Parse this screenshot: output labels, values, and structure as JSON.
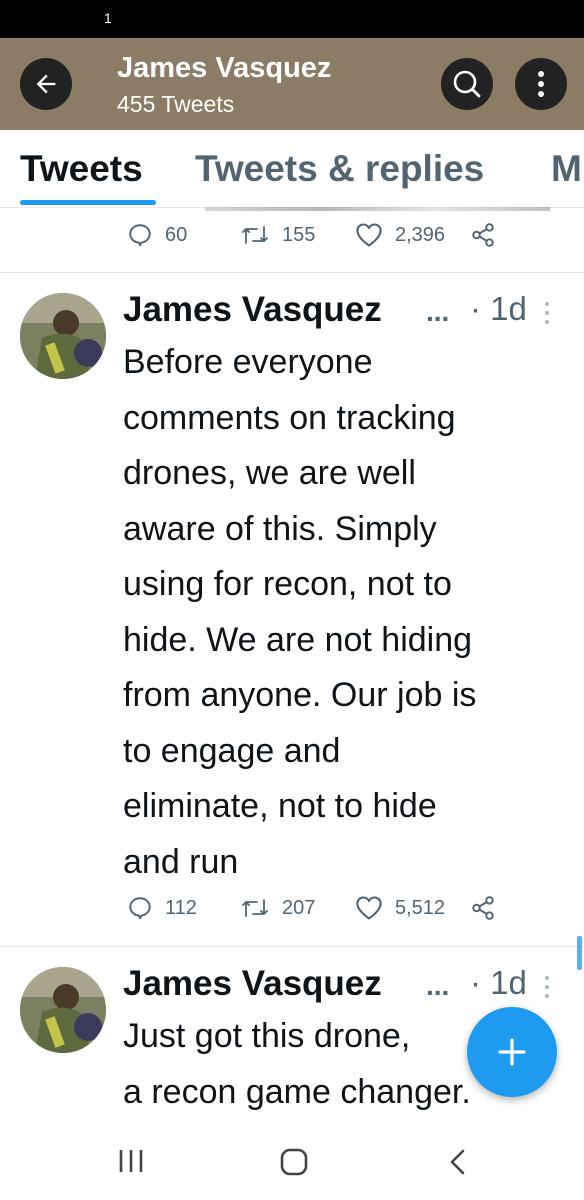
{
  "status_bar": {
    "notification_count": "1"
  },
  "header": {
    "title": "James Vasquez",
    "subtitle": "455 Tweets",
    "icons": {
      "back": "arrow-left-icon",
      "search": "search-icon",
      "more": "more-vertical-icon"
    }
  },
  "tabs": [
    {
      "label": "Tweets",
      "active": true
    },
    {
      "label": "Tweets & replies",
      "active": false
    },
    {
      "label": "M",
      "active": false
    }
  ],
  "previous_tweet": {
    "replies": "60",
    "retweets": "155",
    "likes": "2,396"
  },
  "tweets": [
    {
      "author": "James Vasquez",
      "ellipsis": "...",
      "time": "· 1d",
      "text": "Before everyone\ncomments on tracking\ndrones, we are well\naware of this. Simply\nusing for recon, not to\nhide. We are not hiding\nfrom anyone. Our job is\nto engage and\neliminate, not to hide\nand run",
      "replies": "112",
      "retweets": "207",
      "likes": "5,512"
    },
    {
      "author": "James Vasquez",
      "ellipsis": "...",
      "time": "· 1d",
      "text": "Just got this drone,\na recon game changer."
    }
  ],
  "colors": {
    "header_bg": "#8c7b65",
    "accent": "#1d9bf0",
    "muted_text": "#536471"
  }
}
